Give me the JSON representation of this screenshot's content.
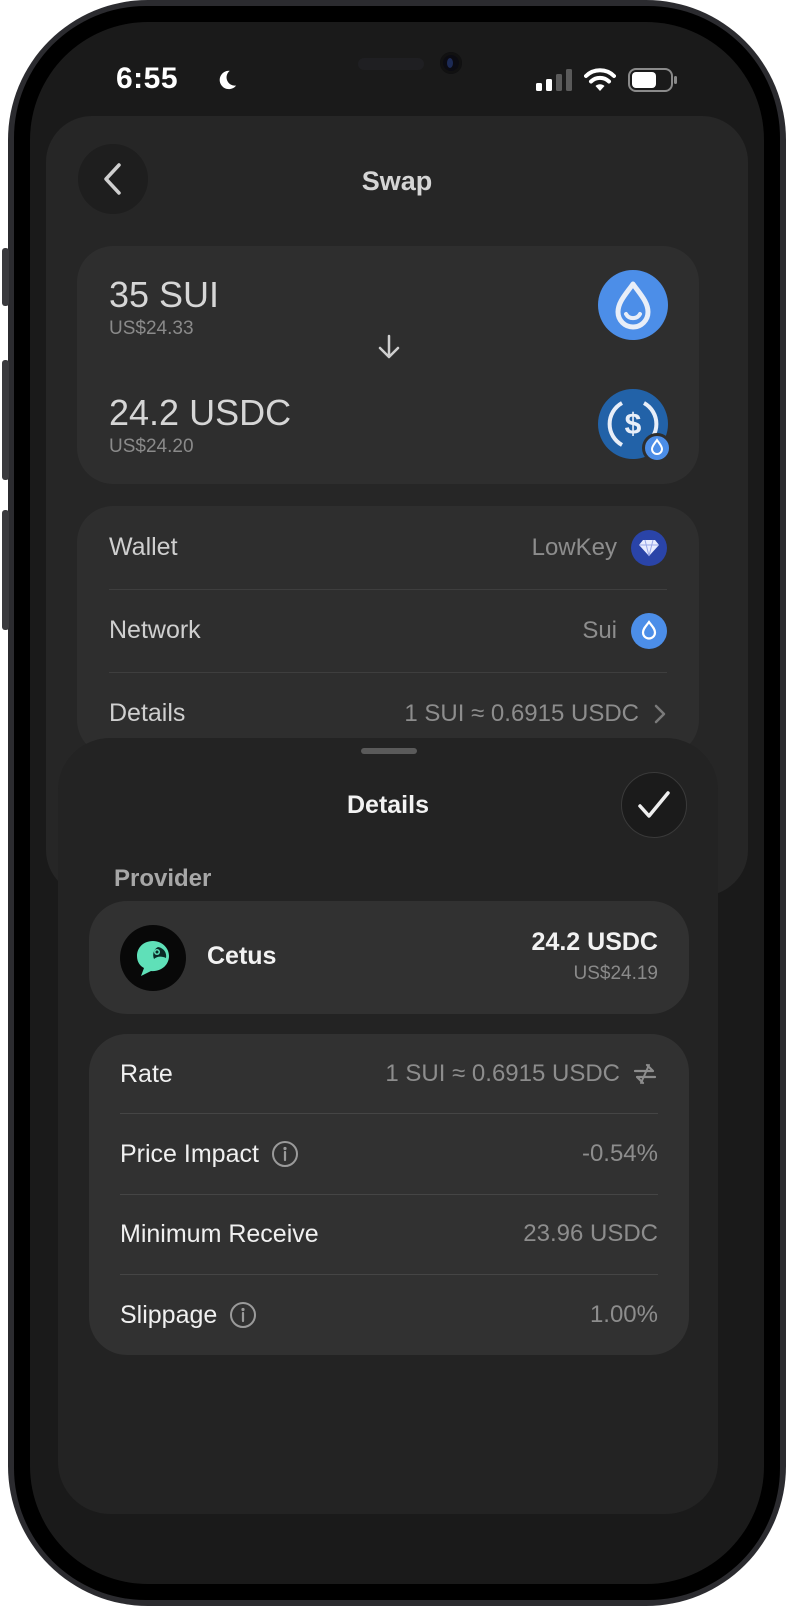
{
  "status_bar": {
    "time": "6:55",
    "icons": [
      "moon-icon",
      "signal-icon",
      "wifi-icon",
      "battery-icon"
    ]
  },
  "swap_screen": {
    "title": "Swap",
    "from": {
      "amount": "35 SUI",
      "fiat": "US$24.33",
      "token_icon": "sui-token-icon"
    },
    "to": {
      "amount": "24.2 USDC",
      "fiat": "US$24.20",
      "token_icon": "usdc-token-icon"
    },
    "rows": [
      {
        "label": "Wallet",
        "value": "LowKey",
        "icon": "diamond-icon"
      },
      {
        "label": "Network",
        "value": "Sui",
        "icon": "sui-network-icon"
      },
      {
        "label": "Details",
        "value": "1 SUI ≈ 0.6915 USDC",
        "icon": "chevron-right-icon"
      }
    ]
  },
  "details_sheet": {
    "title": "Details",
    "provider_label": "Provider",
    "provider": {
      "name": "Cetus",
      "amount": "24.2 USDC",
      "fiat": "US$24.19",
      "logo": "cetus-logo"
    },
    "rows": [
      {
        "label": "Rate",
        "value": "1 SUI ≈ 0.6915 USDC"
      },
      {
        "label": "Price Impact",
        "value": "-0.54%"
      },
      {
        "label": "Minimum Receive",
        "value": "23.96 USDC"
      },
      {
        "label": "Slippage",
        "value": "1.00%"
      }
    ]
  },
  "colors": {
    "background": "#1a1a1a",
    "card": "#2e2e2e",
    "sui_blue": "#4c8ee8",
    "usdc_blue": "#2775ca",
    "cetus_green": "#5fe0b8"
  }
}
